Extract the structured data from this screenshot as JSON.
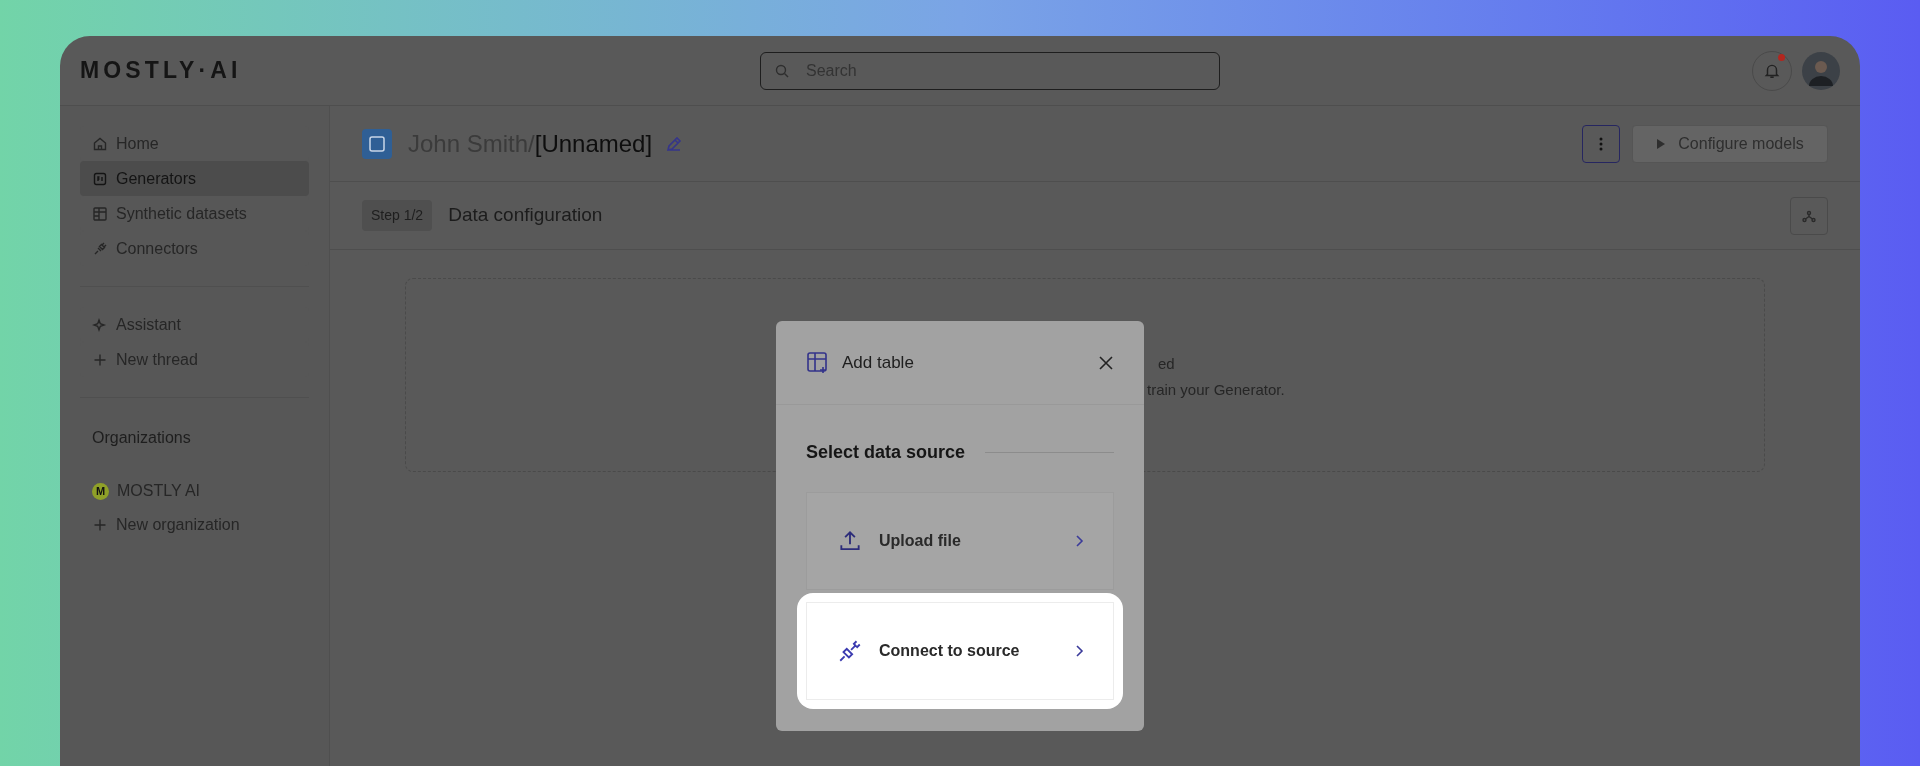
{
  "app": {
    "logo": "MOSTLY·AI",
    "search": {
      "placeholder": "Search"
    },
    "notifications": {
      "unread": true
    }
  },
  "sidebar": {
    "nav": [
      {
        "kind": "home",
        "label": "Home",
        "selected": false
      },
      {
        "kind": "generators",
        "label": "Generators",
        "selected": true
      },
      {
        "kind": "datasets",
        "label": "Synthetic datasets",
        "selected": false
      },
      {
        "kind": "connectors",
        "label": "Connectors",
        "selected": false
      }
    ],
    "assistant": [
      {
        "kind": "assistant",
        "label": "Assistant",
        "selected": false
      },
      {
        "kind": "add",
        "label": "New thread",
        "selected": false
      }
    ],
    "organizations": {
      "heading": "Organizations",
      "items": [
        {
          "kind": "org",
          "badge": "M",
          "label": "MOSTLY AI"
        },
        {
          "kind": "add",
          "label": "New organization"
        }
      ]
    }
  },
  "page": {
    "owner": "John Smith/",
    "name": "[Unnamed]",
    "configure_button": {
      "label": "Configure models",
      "disabled": true
    },
    "step": {
      "badge": "Step 1/2",
      "title": "Data configuration"
    },
    "empty_state": {
      "line_1": "ed",
      "line_2": "train your Generator."
    }
  },
  "modal": {
    "title": "Add table",
    "section": "Select data source",
    "options": [
      {
        "kind": "upload",
        "label": "Upload file",
        "highlighted": false
      },
      {
        "kind": "plug",
        "label": "Connect to source",
        "highlighted": true
      }
    ]
  }
}
